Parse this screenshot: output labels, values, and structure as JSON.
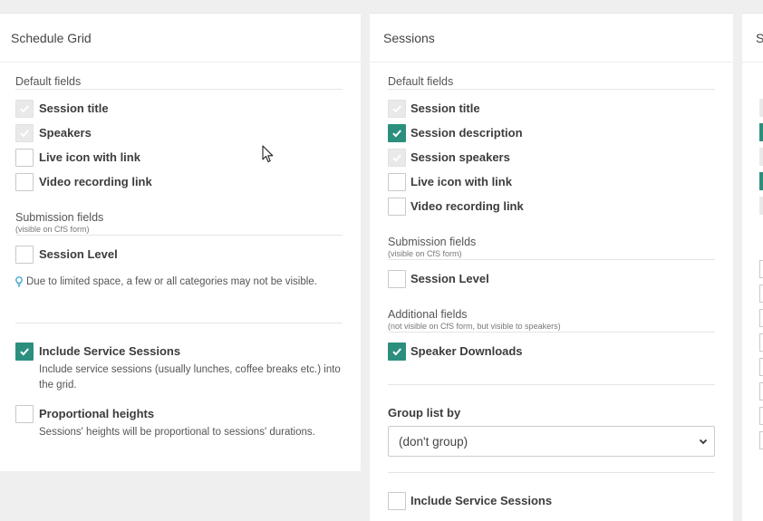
{
  "schedule_grid": {
    "title": "Schedule Grid",
    "default_fields_title": "Default fields",
    "default_fields": [
      {
        "label": "Session title",
        "state": "disabled-checked"
      },
      {
        "label": "Speakers",
        "state": "disabled-checked"
      },
      {
        "label": "Live icon with link",
        "state": "unchecked"
      },
      {
        "label": "Video recording link",
        "state": "unchecked"
      }
    ],
    "submission_fields_title": "Submission fields",
    "submission_fields_sub": "(visible on CfS form)",
    "submission_fields": [
      {
        "label": "Session Level",
        "state": "unchecked"
      }
    ],
    "tip_text": "Due to limited space, a few or all categories may not be visible.",
    "include_service": {
      "label": "Include Service Sessions",
      "state": "checked",
      "desc": "Include service sessions (usually lunches, coffee breaks etc.) into the grid."
    },
    "proportional": {
      "label": "Proportional heights",
      "state": "unchecked",
      "desc": "Sessions' heights will be proportional to sessions' durations."
    }
  },
  "sessions": {
    "title": "Sessions",
    "default_fields_title": "Default fields",
    "default_fields": [
      {
        "label": "Session title",
        "state": "disabled-checked"
      },
      {
        "label": "Session description",
        "state": "checked"
      },
      {
        "label": "Session speakers",
        "state": "disabled-checked"
      },
      {
        "label": "Live icon with link",
        "state": "unchecked"
      },
      {
        "label": "Video recording link",
        "state": "unchecked"
      }
    ],
    "submission_fields_title": "Submission fields",
    "submission_fields_sub": "(visible on CfS form)",
    "submission_fields": [
      {
        "label": "Session Level",
        "state": "unchecked"
      }
    ],
    "additional_fields_title": "Additional fields",
    "additional_fields_sub": "(not visible on CfS form, but visible to speakers)",
    "additional_fields": [
      {
        "label": "Speaker Downloads",
        "state": "checked"
      }
    ],
    "group_list_label": "Group list by",
    "group_list_value": "(don't group)",
    "include_service": {
      "label": "Include Service Sessions",
      "state": "unchecked"
    }
  },
  "third_panel": {
    "title_partial": "S"
  },
  "colors": {
    "accent": "#2c8f7e",
    "tip_icon": "#2a9bd1"
  }
}
